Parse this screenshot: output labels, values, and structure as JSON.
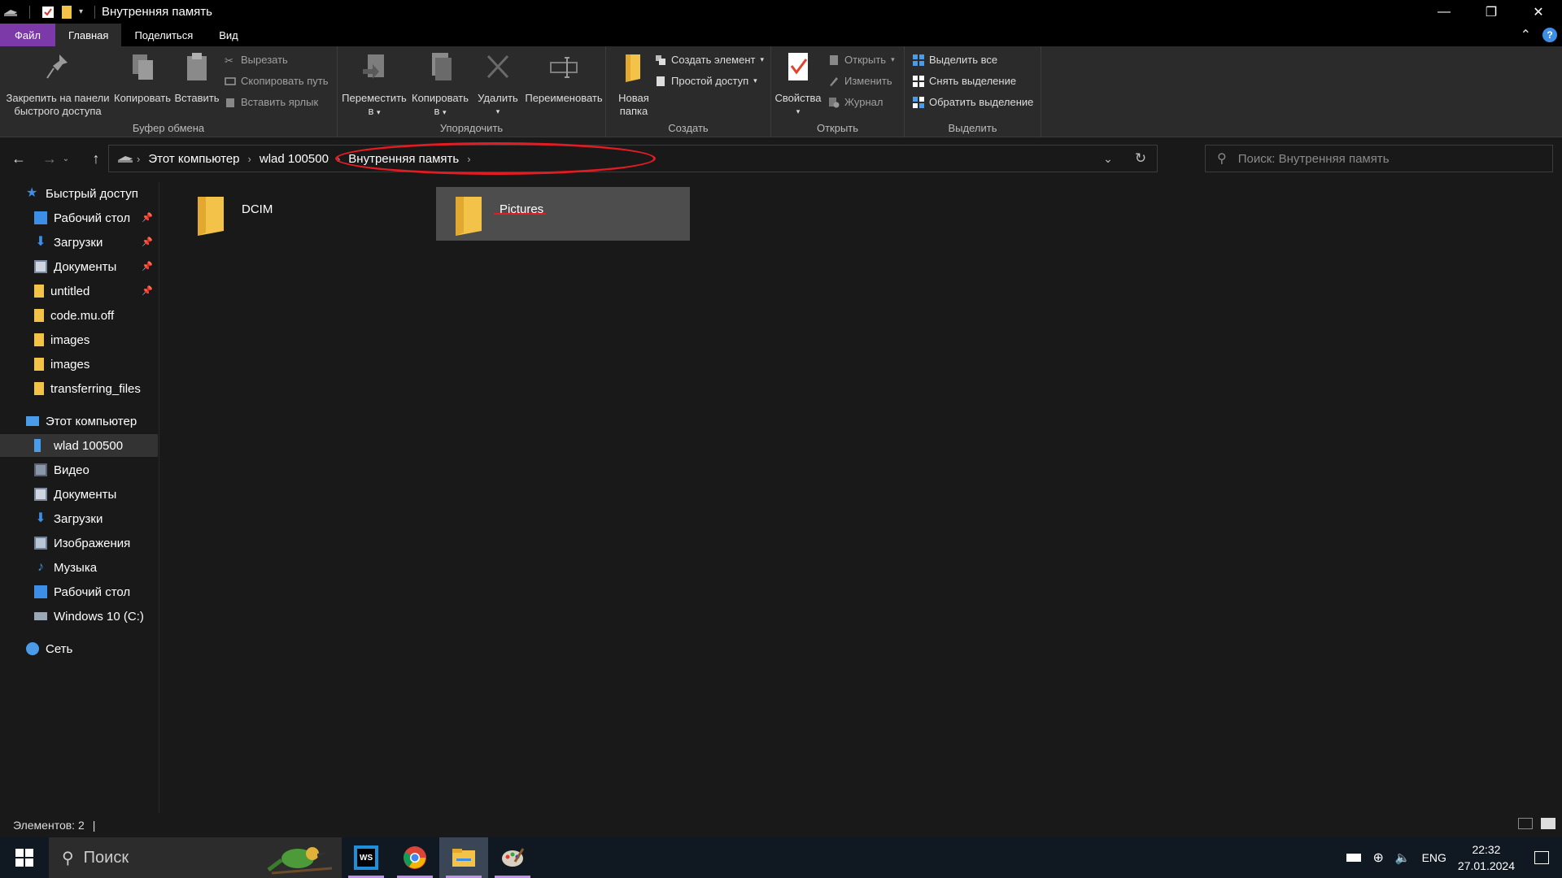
{
  "window": {
    "title": "Внутренняя память",
    "controls": {
      "minimize": "—",
      "maximize": "❐",
      "close": "✕"
    }
  },
  "tabs": [
    {
      "label": "Файл",
      "kind": "file"
    },
    {
      "label": "Главная",
      "kind": "active"
    },
    {
      "label": "Поделиться",
      "kind": "normal"
    },
    {
      "label": "Вид",
      "kind": "normal"
    }
  ],
  "help": {
    "label": "?"
  },
  "ribbon": {
    "clipboard": {
      "label": "Буфер обмена",
      "pin_line1": "Закрепить на панели",
      "pin_line2": "быстрого доступа",
      "copy": "Копировать",
      "paste": "Вставить",
      "cut": "Вырезать",
      "copy_path": "Скопировать путь",
      "paste_shortcut": "Вставить ярлык"
    },
    "organize": {
      "label": "Упорядочить",
      "move_line1": "Переместить",
      "move_line2": "в",
      "copyto_line1": "Копировать",
      "copyto_line2": "в",
      "delete": "Удалить",
      "rename": "Переименовать"
    },
    "create": {
      "label": "Создать",
      "new_folder_line1": "Новая",
      "new_folder_line2": "папка",
      "new_item": "Создать элемент",
      "easy_access": "Простой доступ"
    },
    "open": {
      "label": "Открыть",
      "properties": "Свойства",
      "open": "Открыть",
      "edit": "Изменить",
      "history": "Журнал"
    },
    "select": {
      "label": "Выделить",
      "select_all": "Выделить все",
      "select_none": "Снять выделение",
      "invert": "Обратить выделение"
    }
  },
  "address": {
    "crumbs": [
      "Этот компьютер",
      "wlad 100500",
      "Внутренняя память"
    ]
  },
  "search": {
    "placeholder": "Поиск: Внутренняя память"
  },
  "sidebar": {
    "quick_access": "Быстрый доступ",
    "quick_items": [
      {
        "label": "Рабочий стол",
        "icon": "desktop-icon",
        "pinned": true
      },
      {
        "label": "Загрузки",
        "icon": "downloads-icon",
        "pinned": true
      },
      {
        "label": "Документы",
        "icon": "documents-icon",
        "pinned": true
      },
      {
        "label": "untitled",
        "icon": "folder-icon",
        "pinned": true
      },
      {
        "label": "code.mu.off",
        "icon": "folder-icon",
        "pinned": false
      },
      {
        "label": "images",
        "icon": "folder-icon",
        "pinned": false
      },
      {
        "label": "images",
        "icon": "folder-icon",
        "pinned": false
      },
      {
        "label": "transferring_files",
        "icon": "folder-icon",
        "pinned": false
      }
    ],
    "this_pc": "Этот компьютер",
    "pc_items": [
      {
        "label": "wlad 100500",
        "icon": "phone-icon",
        "selected": true
      },
      {
        "label": "Видео",
        "icon": "video-icon",
        "selected": false
      },
      {
        "label": "Документы",
        "icon": "documents-icon",
        "selected": false
      },
      {
        "label": "Загрузки",
        "icon": "downloads-icon",
        "selected": false
      },
      {
        "label": "Изображения",
        "icon": "pictures-icon",
        "selected": false
      },
      {
        "label": "Музыка",
        "icon": "music-icon",
        "selected": false
      },
      {
        "label": "Рабочий стол",
        "icon": "desktop-icon",
        "selected": false
      },
      {
        "label": "Windows 10 (C:)",
        "icon": "drive-icon",
        "selected": false
      }
    ],
    "network": "Сеть"
  },
  "content": {
    "items": [
      {
        "name": "DCIM",
        "selected": false
      },
      {
        "name": "Pictures",
        "selected": true
      }
    ]
  },
  "status": {
    "count": "Элементов: 2",
    "cursor": "|"
  },
  "taskbar": {
    "search_label": "Поиск",
    "apps": [
      "webstorm-icon",
      "chrome-icon",
      "explorer-icon",
      "paint-icon"
    ],
    "tray": {
      "lang": "ENG",
      "time": "22:32",
      "date": "27.01.2024"
    }
  },
  "colors": {
    "accent_file_tab": "#7b3aa8",
    "annotation_red": "#e51b23",
    "folder_yellow": "#f3c249"
  }
}
